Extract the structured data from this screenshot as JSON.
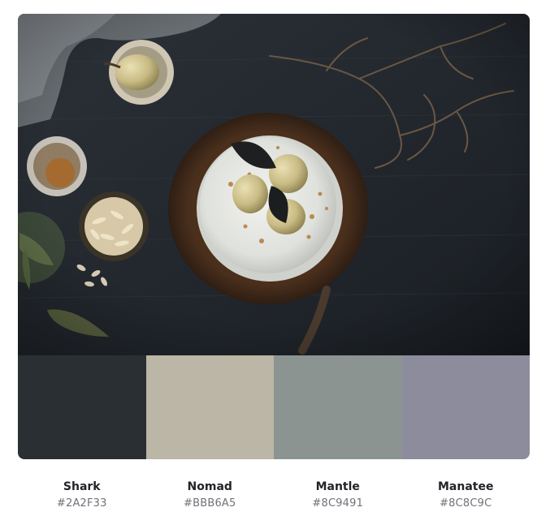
{
  "palette": [
    {
      "name": "Shark",
      "hex": "#2A2F33"
    },
    {
      "name": "Nomad",
      "hex": "#BBB6A5"
    },
    {
      "name": "Mantle",
      "hex": "#8C9491"
    },
    {
      "name": "Manatee",
      "hex": "#8C8C9C"
    }
  ]
}
